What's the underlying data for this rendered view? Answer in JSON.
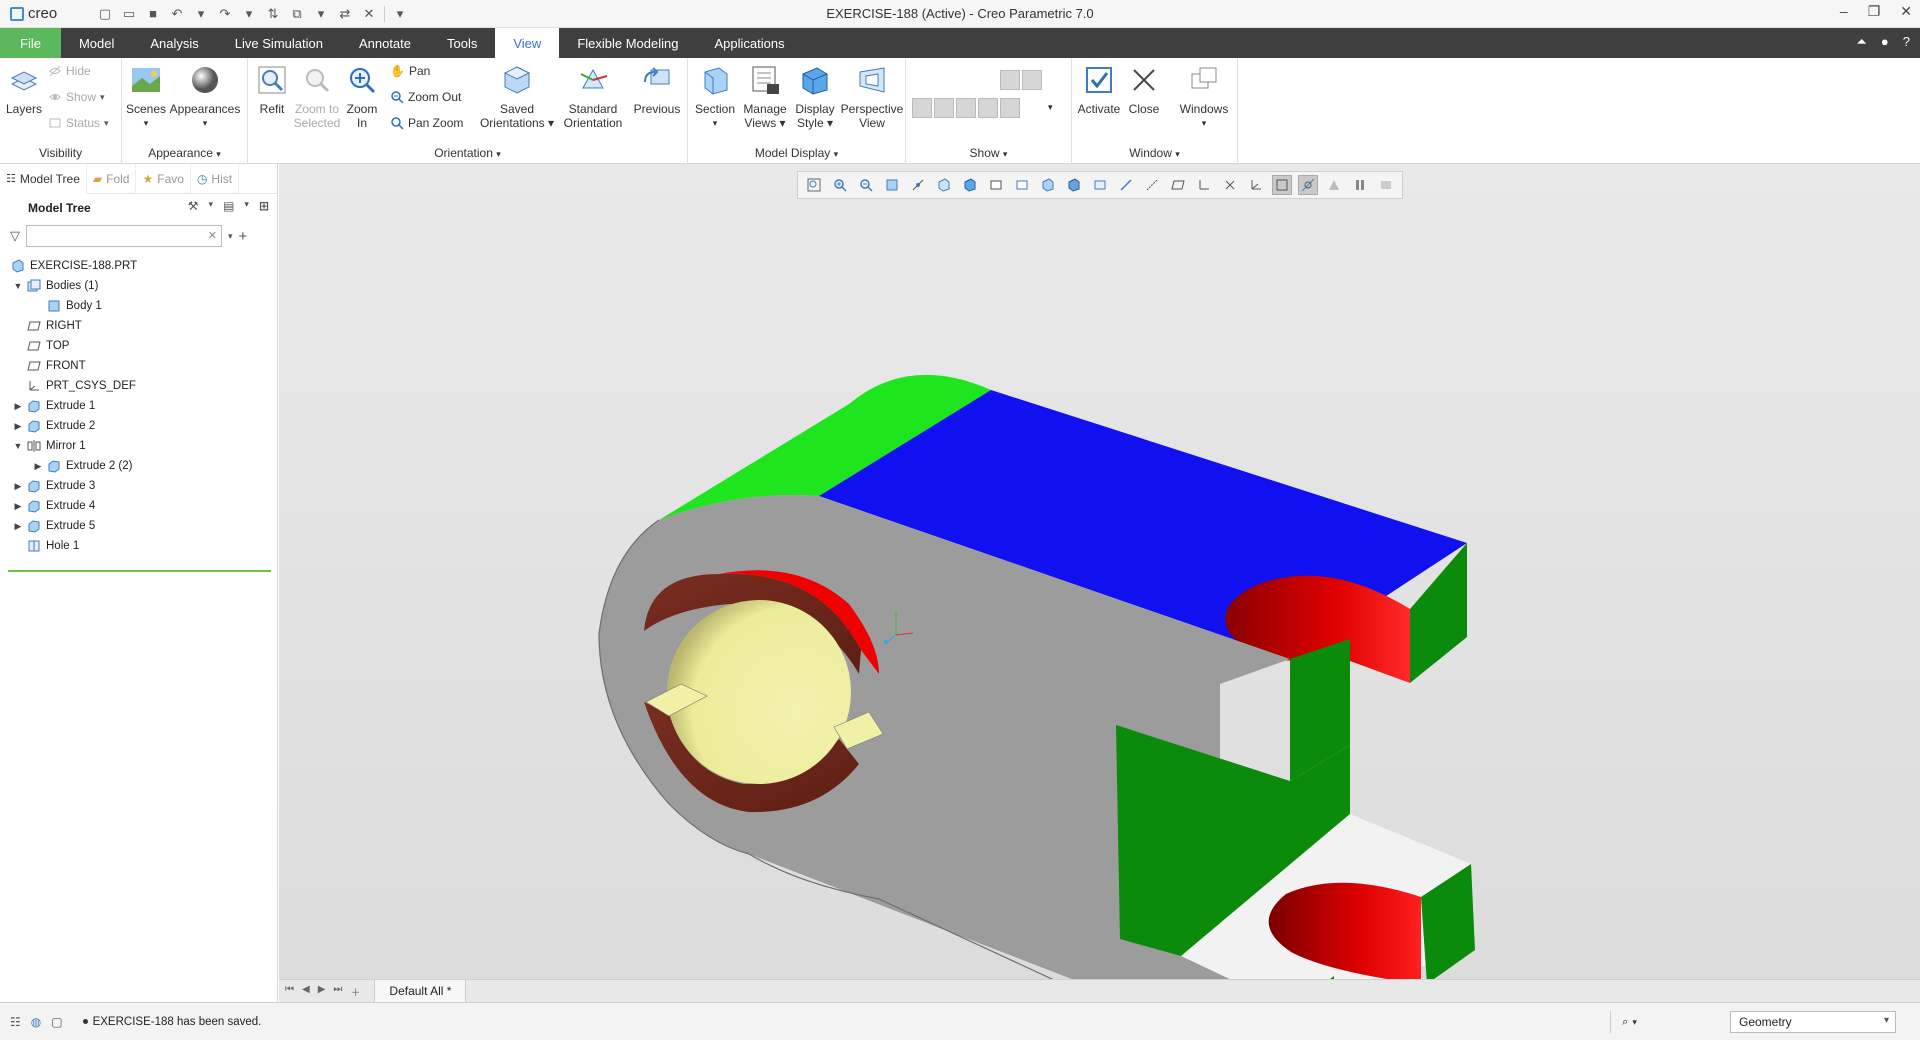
{
  "app": {
    "brand": "creo",
    "window_title": "EXERCISE-188 (Active) - Creo Parametric 7.0"
  },
  "tabs": [
    {
      "label": "File"
    },
    {
      "label": "Model"
    },
    {
      "label": "Analysis"
    },
    {
      "label": "Live Simulation"
    },
    {
      "label": "Annotate"
    },
    {
      "label": "Tools"
    },
    {
      "label": "View"
    },
    {
      "label": "Flexible Modeling"
    },
    {
      "label": "Applications"
    }
  ],
  "ribbon": {
    "visibility": {
      "label": "Visibility",
      "layers": "Layers",
      "hide": "Hide",
      "show": "Show",
      "status": "Status"
    },
    "appearance": {
      "label": "Appearance",
      "scenes": "Scenes",
      "appearances": "Appearances"
    },
    "orientation": {
      "label": "Orientation",
      "refit": "Refit",
      "zoom_to_selected_1": "Zoom to",
      "zoom_to_selected_2": "Selected",
      "zoom_in_1": "Zoom",
      "zoom_in_2": "In",
      "pan": "Pan",
      "zoom_out": "Zoom Out",
      "pan_zoom": "Pan Zoom",
      "saved_1": "Saved",
      "saved_2": "Orientations",
      "standard_1": "Standard",
      "standard_2": "Orientation",
      "previous": "Previous"
    },
    "model_display": {
      "label": "Model Display",
      "section": "Section",
      "manage_1": "Manage",
      "manage_2": "Views",
      "display_1": "Display",
      "display_2": "Style",
      "perspective_1": "Perspective",
      "perspective_2": "View"
    },
    "show": {
      "label": "Show"
    },
    "window": {
      "label": "Window",
      "activate": "Activate",
      "close": "Close",
      "windows": "Windows"
    }
  },
  "panel": {
    "tabs": [
      {
        "label": "Model Tree"
      },
      {
        "label": "Fold"
      },
      {
        "label": "Favo"
      },
      {
        "label": "Hist"
      }
    ],
    "tree_title": "Model Tree",
    "filter_placeholder": "",
    "items": [
      {
        "label": "EXERCISE-188.PRT"
      },
      {
        "label": "Bodies (1)"
      },
      {
        "label": "Body 1"
      },
      {
        "label": "RIGHT"
      },
      {
        "label": "TOP"
      },
      {
        "label": "FRONT"
      },
      {
        "label": "PRT_CSYS_DEF"
      },
      {
        "label": "Extrude 1"
      },
      {
        "label": "Extrude 2"
      },
      {
        "label": "Mirror 1"
      },
      {
        "label": "Extrude 2 (2)"
      },
      {
        "label": "Extrude 3"
      },
      {
        "label": "Extrude 4"
      },
      {
        "label": "Extrude 5"
      },
      {
        "label": "Hole 1"
      }
    ]
  },
  "bottom": {
    "layer_tab": "Default All *"
  },
  "status": {
    "message": "EXERCISE-188 has been saved.",
    "filter_value": "Geometry"
  },
  "colors": {
    "accent_tab": "#3a6fd8",
    "file_tab": "#5cb85c",
    "tree_end": "#6cc04a"
  }
}
